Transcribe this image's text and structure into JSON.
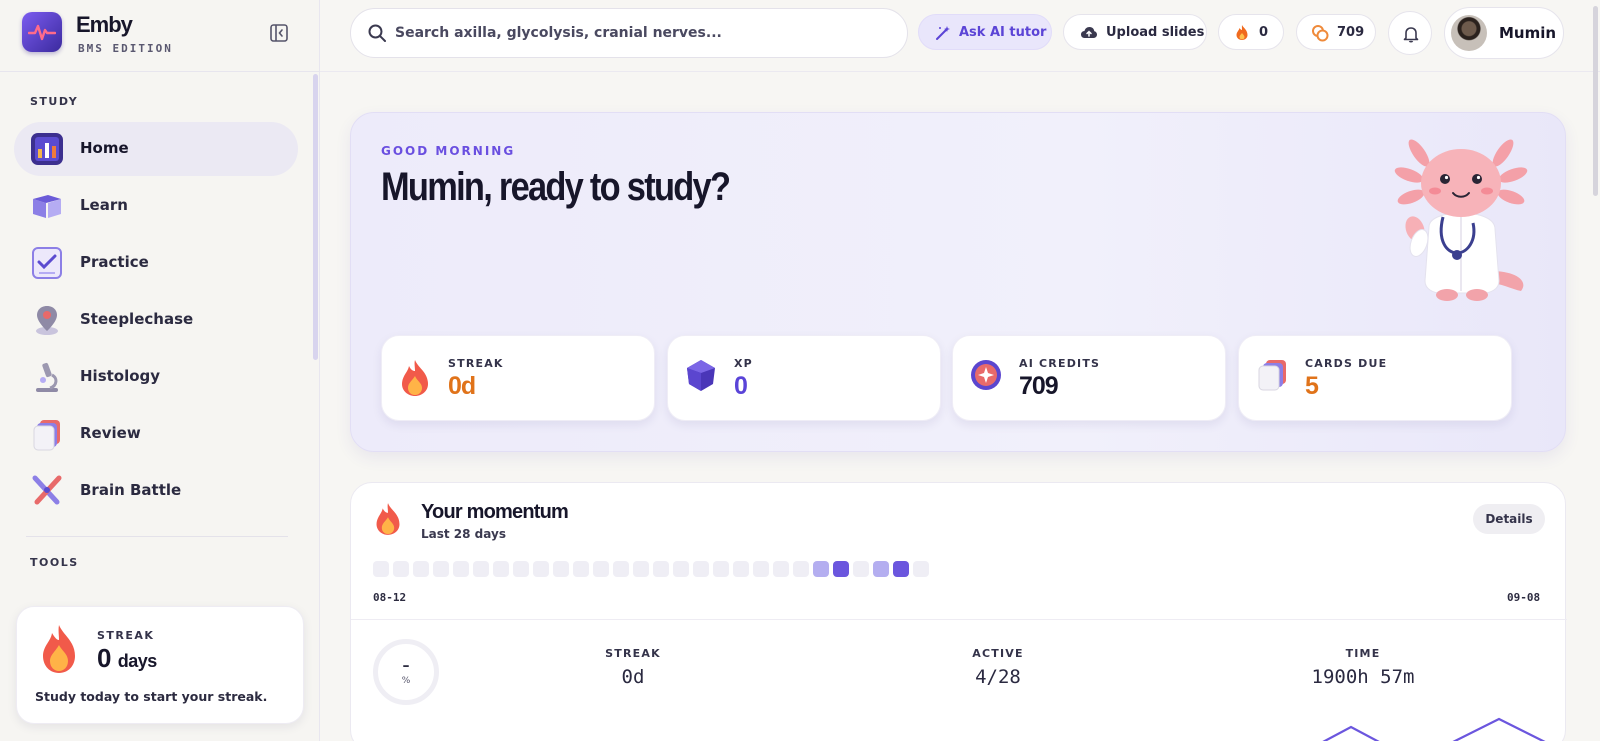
{
  "brand": {
    "name": "Emby",
    "edition": "BMS EDITION"
  },
  "sidebar": {
    "study_label": "STUDY",
    "tools_label": "TOOLS",
    "items": [
      {
        "label": "Home",
        "icon": "chart-icon",
        "active": true
      },
      {
        "label": "Learn",
        "icon": "book-icon"
      },
      {
        "label": "Practice",
        "icon": "checklist-icon"
      },
      {
        "label": "Steeplechase",
        "icon": "map-pin-icon"
      },
      {
        "label": "Histology",
        "icon": "microscope-icon"
      },
      {
        "label": "Review",
        "icon": "cards-icon"
      },
      {
        "label": "Brain Battle",
        "icon": "crossed-swords-icon"
      }
    ],
    "streak_card": {
      "label": "STREAK",
      "value": "0",
      "unit": "days",
      "text": "Study today to start your streak."
    }
  },
  "topbar": {
    "search_placeholder": "Search axilla, glycolysis, cranial nerves...",
    "ask_ai": "Ask AI tutor",
    "upload": "Upload slides",
    "streak_count": "0",
    "credits_count": "709",
    "user_name": "Mumin"
  },
  "hero": {
    "kicker": "GOOD MORNING",
    "title": "Mumin, ready to study?",
    "stats": [
      {
        "label": "STREAK",
        "value": "0d",
        "color": "#e0731a",
        "icon": "flame-icon"
      },
      {
        "label": "XP",
        "value": "0",
        "color": "#5a44d8",
        "icon": "gem-icon"
      },
      {
        "label": "AI CREDITS",
        "value": "709",
        "color": "#17162a",
        "icon": "credit-coin-icon"
      },
      {
        "label": "CARDS DUE",
        "value": "5",
        "color": "#e0731a",
        "icon": "card-stack-icon"
      }
    ]
  },
  "momentum": {
    "title": "Your momentum",
    "subtitle": "Last 28 days",
    "details": "Details",
    "activity": [
      0,
      0,
      0,
      0,
      0,
      0,
      0,
      0,
      0,
      0,
      0,
      0,
      0,
      0,
      0,
      0,
      0,
      0,
      0,
      0,
      0,
      0,
      1,
      2,
      0,
      1,
      2,
      0
    ],
    "start_date": "08-12",
    "end_date": "09-08",
    "ring_value": "–",
    "ring_unit": "%",
    "stats": [
      {
        "label": "STREAK",
        "value": "0d"
      },
      {
        "label": "ACTIVE",
        "value": "4/28"
      },
      {
        "label": "TIME",
        "value": "1900h 57m"
      }
    ]
  },
  "colors": {
    "accent": "#6a4fe0",
    "orange": "#e0731a",
    "ink": "#17162a"
  }
}
